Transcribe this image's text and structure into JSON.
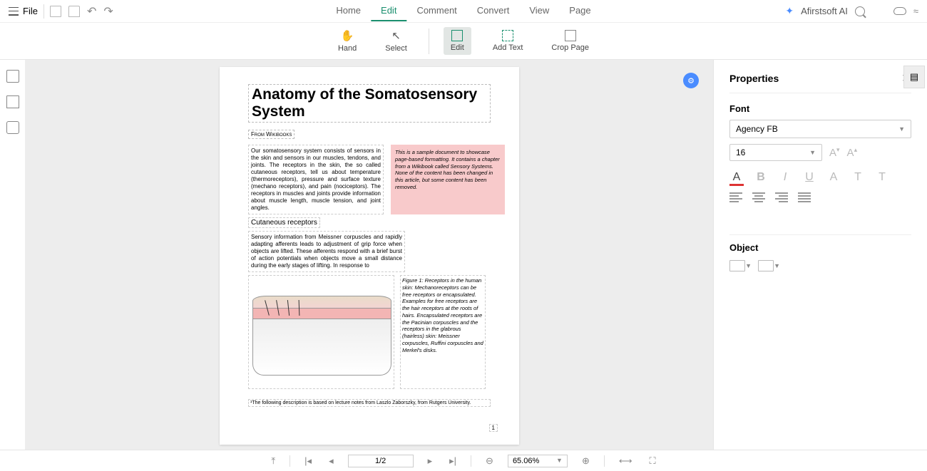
{
  "menu": {
    "file": "File"
  },
  "tabs": {
    "home": "Home",
    "edit": "Edit",
    "comment": "Comment",
    "convert": "Convert",
    "view": "View",
    "page": "Page"
  },
  "ai": {
    "label": "Afirstsoft AI"
  },
  "tools": {
    "hand": "Hand",
    "select": "Select",
    "edit": "Edit",
    "addtext": "Add Text",
    "crop": "Crop Page"
  },
  "doc": {
    "title": "Anatomy of the Somatosensory System",
    "subtitle": "From Wikibooks",
    "para1": "Our somatosensory system consists of sensors in the skin and sensors in our muscles, tendons, and joints. The receptors in the skin, the so called cutaneous receptors, tell us about temperature (thermoreceptors), pressure and surface texture (mechano receptors), and pain (nociceptors). The receptors in muscles and joints provide information about muscle length, muscle tension, and joint angles.",
    "callout": "This is a sample document to showcase page-based formatting. It contains a chapter from a Wikibook called Sensory Systems. None of the content has been changed in this article, but some content has been removed.",
    "h2": "Cutaneous receptors",
    "para2": "Sensory information from Meissner corpuscles and rapidly adapting afferents leads to adjustment of grip force when objects are lifted. These afferents respond with a brief burst of action potentials when objects move a small distance during the early stages of lifting. In response to",
    "figcap": "Figure 1: Receptors in the human skin: Mechanoreceptors can be free receptors or encapsulated. Examples for free receptors are the hair receptors at the roots of hairs. Encapsulated receptors are the Pacinian corpuscles and the receptors in the glabrous (hairless) skin: Meissner corpuscles, Ruffini corpuscles and Merkel's disks.",
    "footnote": "¹The following description is based on lecture notes from Laszlo Zaborszky, from Rutgers University.",
    "pagenum": "1"
  },
  "panel": {
    "title": "Properties",
    "font_label": "Font",
    "font_family": "Agency FB",
    "font_size": "16",
    "object_label": "Object"
  },
  "footer": {
    "page_indicator": "1/2",
    "zoom": "65.06%"
  }
}
